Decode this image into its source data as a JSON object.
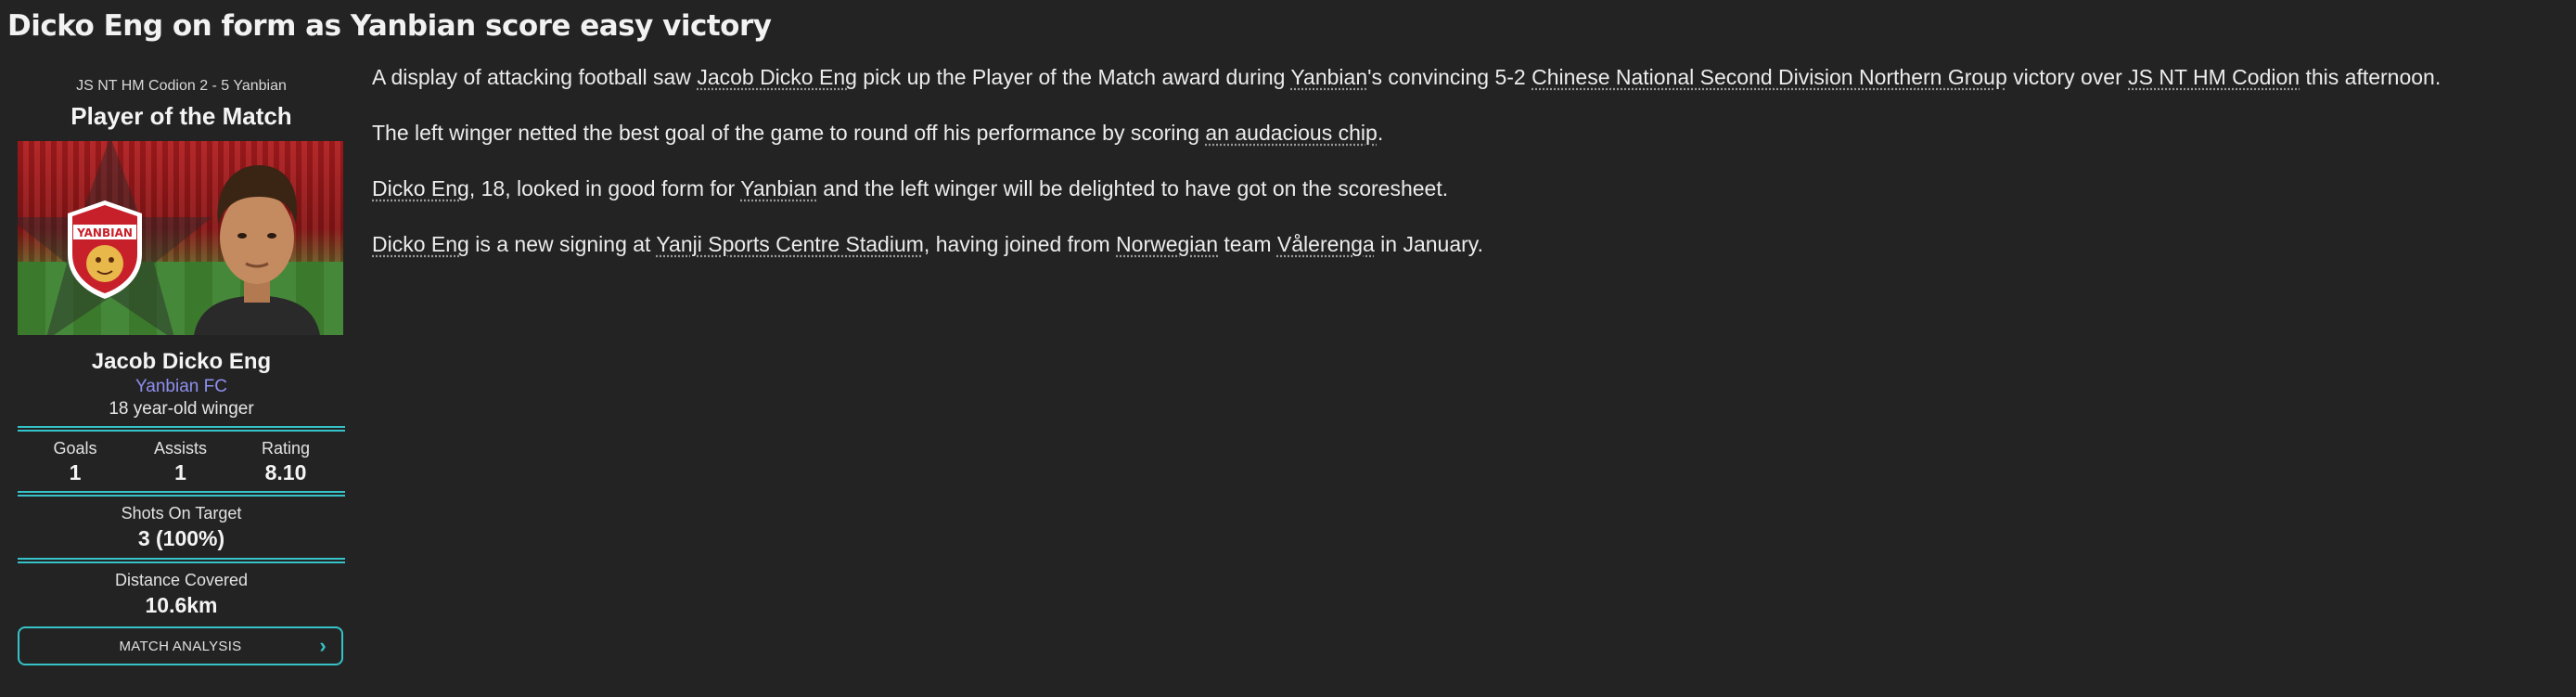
{
  "headline": "Dicko Eng on form as Yanbian score easy victory",
  "sidebar": {
    "fixture": "JS NT HM Codion 2 - 5 Yanbian",
    "title": "Player of the Match",
    "club_badge_text": "YANBIAN",
    "player_name": "Jacob Dicko Eng",
    "club": "Yanbian FC",
    "age_position": "18 year-old winger",
    "stats": [
      {
        "label": "Goals",
        "value": "1"
      },
      {
        "label": "Assists",
        "value": "1"
      },
      {
        "label": "Rating",
        "value": "8.10"
      }
    ],
    "shots": {
      "label": "Shots On Target",
      "value": "3 (100%)"
    },
    "distance": {
      "label": "Distance Covered",
      "value": "10.6km"
    },
    "button_label": "MATCH ANALYSIS",
    "button_icon": "chevron-right-icon"
  },
  "article": {
    "p1": {
      "t1": "A display of attacking football saw ",
      "l1": "Jacob Dicko Eng",
      "t2": " pick up the Player of the Match award during ",
      "l2": "Yanbian",
      "t3": "'s convincing 5-2 ",
      "l3": "Chinese National Second Division Northern Group",
      "t4": " victory over ",
      "l4": "JS NT HM Codion",
      "t5": " this afternoon."
    },
    "p2": {
      "t1": "The left winger netted the best goal of the game to round off his performance by scoring ",
      "l1": "an audacious chip",
      "t2": "."
    },
    "p3": {
      "l1": "Dicko Eng",
      "t1": ", 18, looked in good form for ",
      "l2": "Yanbian",
      "t2": " and the left winger will be delighted to have got on the scoresheet."
    },
    "p4": {
      "l1": "Dicko Eng",
      "t1": " is a new signing at ",
      "l2": "Yanji Sports Centre Stadium",
      "t2": ", having joined from ",
      "l3": "Norwegian",
      "t3": " team ",
      "l4": "Vålerenga",
      "t4": " in January."
    }
  },
  "colors": {
    "background": "#232323",
    "accent": "#35c3c9",
    "club_link": "#8f8ff0"
  }
}
